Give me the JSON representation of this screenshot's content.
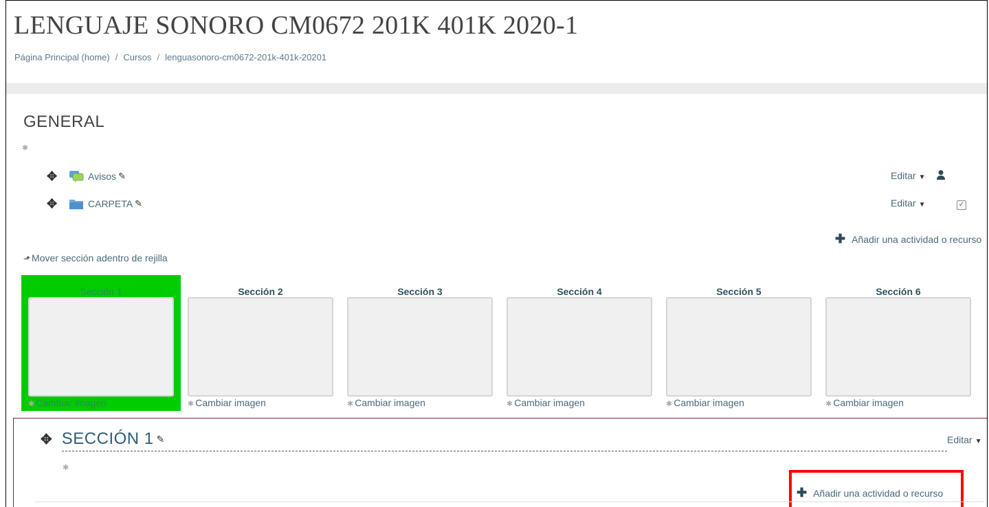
{
  "header": {
    "title": "LENGUAJE SONORO CM0672 201K 401K 2020-1",
    "breadcrumb": [
      {
        "label": "Página Principal (home)"
      },
      {
        "label": "Cursos"
      },
      {
        "label": "lenguasonoro-cm0672-201k-401k-20201"
      }
    ],
    "breadcrumb_separator": "/"
  },
  "general": {
    "title": "GENERAL",
    "activities": [
      {
        "name": "Avisos",
        "icon": "forum-icon",
        "edit_label": "Editar",
        "extra_icon": "user-icon"
      },
      {
        "name": "CARPETA",
        "icon": "folder-icon",
        "edit_label": "Editar",
        "extra_icon": "checkbox-icon"
      }
    ],
    "add_activity_label": "Añadir una actividad o recurso"
  },
  "move_section_label": "Mover sección adentro de rejilla",
  "tiles": [
    {
      "title": "Sección 1",
      "change_image_label": "Cambiar imagen",
      "active": true
    },
    {
      "title": "Sección 2",
      "change_image_label": "Cambiar imagen",
      "active": false
    },
    {
      "title": "Sección 3",
      "change_image_label": "Cambiar imagen",
      "active": false
    },
    {
      "title": "Sección 4",
      "change_image_label": "Cambiar imagen",
      "active": false
    },
    {
      "title": "Sección 5",
      "change_image_label": "Cambiar imagen",
      "active": false
    },
    {
      "title": "Sección 6",
      "change_image_label": "Cambiar imagen",
      "active": false
    }
  ],
  "section1": {
    "title": "SECCIÓN 1",
    "edit_label": "Editar",
    "add_activity_label": "Añadir una actividad o recurso"
  },
  "colors": {
    "active_tile": "#00cc00",
    "highlight": "#ff0000",
    "section_border": "#8b1d3a",
    "link": "#4a6a7a"
  }
}
